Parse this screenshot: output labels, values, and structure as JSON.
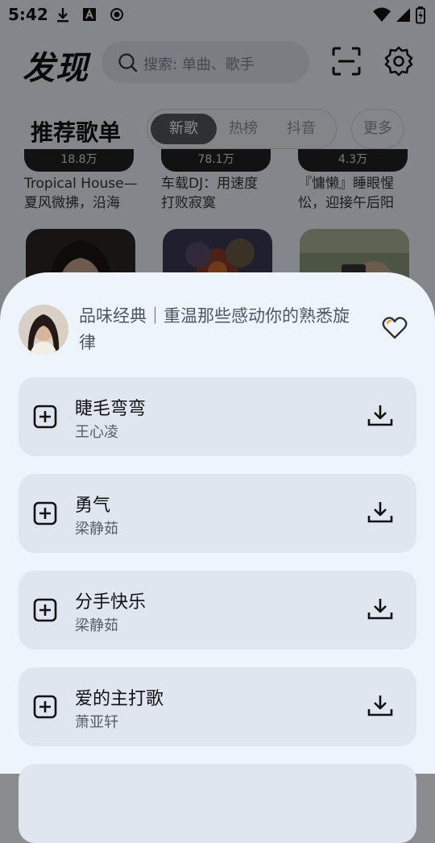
{
  "status_bar": {
    "time": "5:42"
  },
  "header": {
    "title": "发现",
    "search_placeholder": "搜索: 单曲、歌手"
  },
  "section": {
    "title": "推荐歌单",
    "tabs": [
      {
        "label": "新歌",
        "active": true
      },
      {
        "label": "热榜",
        "active": false
      },
      {
        "label": "抖音",
        "active": false
      }
    ],
    "more_label": "更多"
  },
  "playlists": [
    {
      "play_count": "18.8万",
      "caption_line1": "Tropical House—",
      "caption_line2": "夏风微拂，沿海"
    },
    {
      "play_count": "78.1万",
      "caption_line1": "车载DJ：用速度",
      "caption_line2": "打败寂寞"
    },
    {
      "play_count": "4.3万",
      "caption_line1": "『慵懒』睡眼惺",
      "caption_line2": "忪，迎接午后阳"
    }
  ],
  "sheet": {
    "playlist_title": "品味经典｜重温那些感动你的熟悉旋律",
    "songs": [
      {
        "title": "睫毛弯弯",
        "artist": "王心凌"
      },
      {
        "title": "勇气",
        "artist": "梁静茹"
      },
      {
        "title": "分手快乐",
        "artist": "梁静茹"
      },
      {
        "title": "爱的主打歌",
        "artist": "萧亚轩"
      }
    ]
  },
  "colors": {
    "accent": "#555a60",
    "sheet_bg": "#eef4fc",
    "card_bg": "#dfe6f0"
  }
}
